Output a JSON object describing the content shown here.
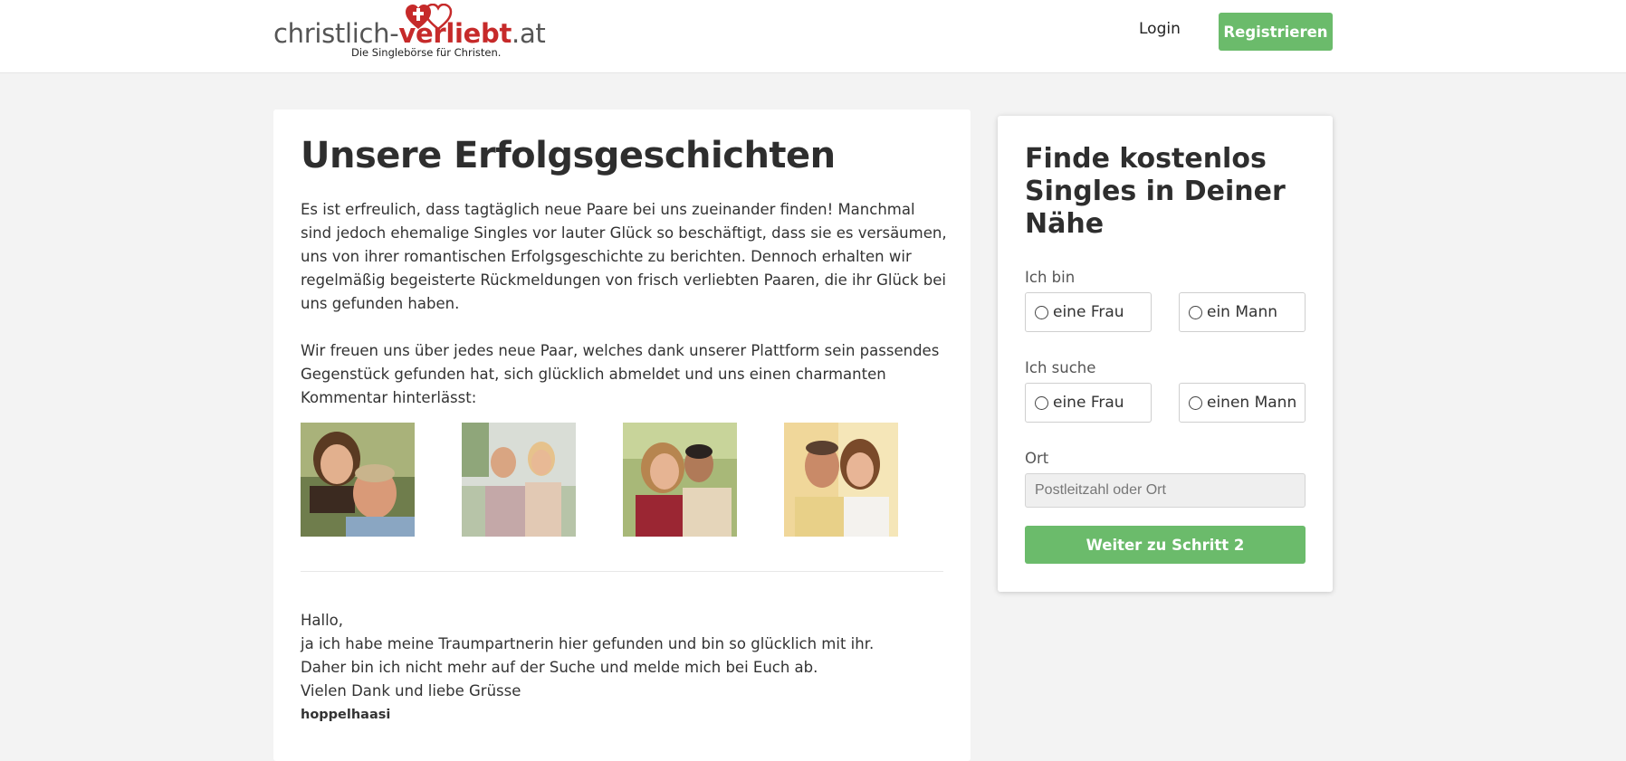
{
  "header": {
    "logo_prefix": "christlich-",
    "logo_bold": "verliebt",
    "logo_suffix": ".at",
    "logo_tagline": "Die Singlebörse für Christen.",
    "login_label": "Login",
    "register_label": "Registrieren"
  },
  "main": {
    "title": "Unsere Erfolgsgeschichten",
    "paragraphs": [
      "Es ist erfreulich, dass tagtäglich neue Paare bei uns zueinander finden! Manchmal sind jedoch ehemalige Singles vor lauter Glück so beschäftigt, dass sie es versäumen, uns von ihrer romantischen Erfolgsgeschichte zu berichten. Dennoch erhalten wir regelmäßig begeisterte Rückmeldungen von frisch verliebten Paaren, die ihr Glück bei uns gefunden haben.",
      "Wir freuen uns über jedes neue Paar, welches dank unserer Plattform sein passendes Gegenstück gefunden hat, sich glücklich abmeldet und uns einen charmanten Kommentar hinterlässt:"
    ],
    "story": {
      "lines": [
        "Hallo,",
        "ja ich habe meine Traumpartnerin hier gefunden und bin so glücklich mit ihr.",
        "Daher bin ich nicht mehr auf der Suche und melde mich bei Euch ab.",
        "Vielen Dank und liebe Grüsse"
      ],
      "author": "hoppelhaasi"
    }
  },
  "signup": {
    "title": "Finde kostenlos Singles in Deiner Nähe",
    "iam_label": "Ich bin",
    "iam_options": [
      "eine Frau",
      "ein Mann"
    ],
    "seek_label": "Ich suche",
    "seek_options": [
      "eine Frau",
      "einen Mann"
    ],
    "location_label": "Ort",
    "location_placeholder": "Postleitzahl oder Ort",
    "submit_label": "Weiter zu Schritt 2"
  },
  "colors": {
    "brand_red": "#c62a2a",
    "accent_green": "#6bbb6b",
    "page_bg": "#f3f3f3"
  }
}
